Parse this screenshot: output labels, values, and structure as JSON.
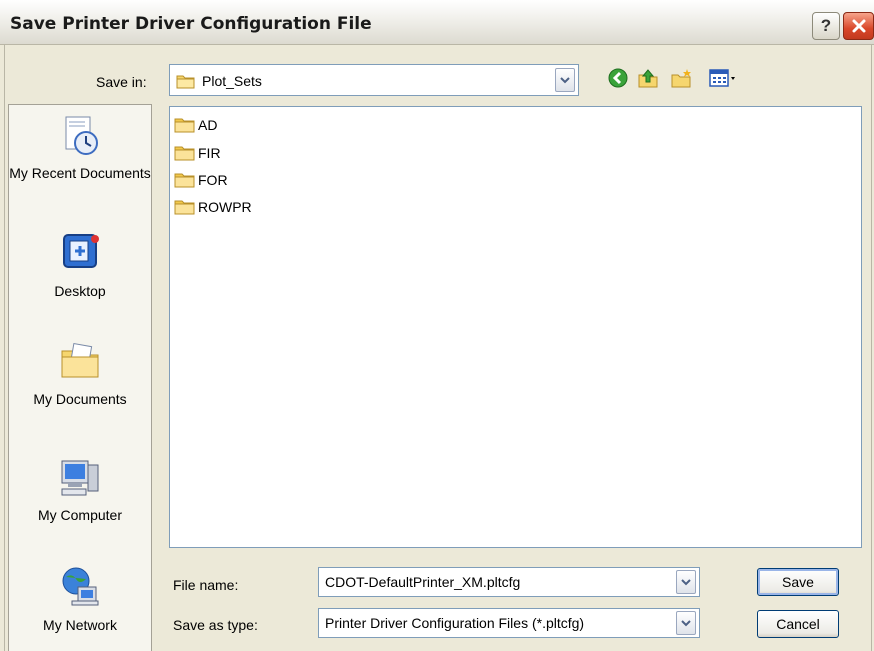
{
  "window": {
    "title": "Save Printer Driver Configuration File",
    "help_label": "?",
    "colors": {
      "titlebar": "#f0efea",
      "close": "#d9472a",
      "dialog_bg": "#ECE9D8"
    }
  },
  "save_in": {
    "label": "Save in:",
    "value": "Plot_Sets",
    "icon": "folder-icon"
  },
  "toolbar": {
    "icons": [
      "back-icon",
      "up-one-level-icon",
      "create-new-folder-icon",
      "view-menu-icon"
    ]
  },
  "places": [
    {
      "label": "My Recent Documents",
      "icon": "recent-documents-icon"
    },
    {
      "label": "Desktop",
      "icon": "desktop-icon"
    },
    {
      "label": "My Documents",
      "icon": "my-documents-icon"
    },
    {
      "label": "My Computer",
      "icon": "my-computer-icon"
    },
    {
      "label": "My Network",
      "icon": "my-network-icon"
    }
  ],
  "files": [
    {
      "name": "AD",
      "icon": "folder-icon"
    },
    {
      "name": "FIR",
      "icon": "folder-icon"
    },
    {
      "name": "FOR",
      "icon": "folder-icon"
    },
    {
      "name": "ROWPR",
      "icon": "folder-icon"
    }
  ],
  "form": {
    "file_name_label": "File name:",
    "file_name_value": "CDOT-DefaultPrinter_XM.pltcfg",
    "save_as_type_label": "Save as type:",
    "save_as_type_value": "Printer Driver Configuration Files (*.pltcfg)"
  },
  "buttons": {
    "save": "Save",
    "cancel": "Cancel"
  }
}
